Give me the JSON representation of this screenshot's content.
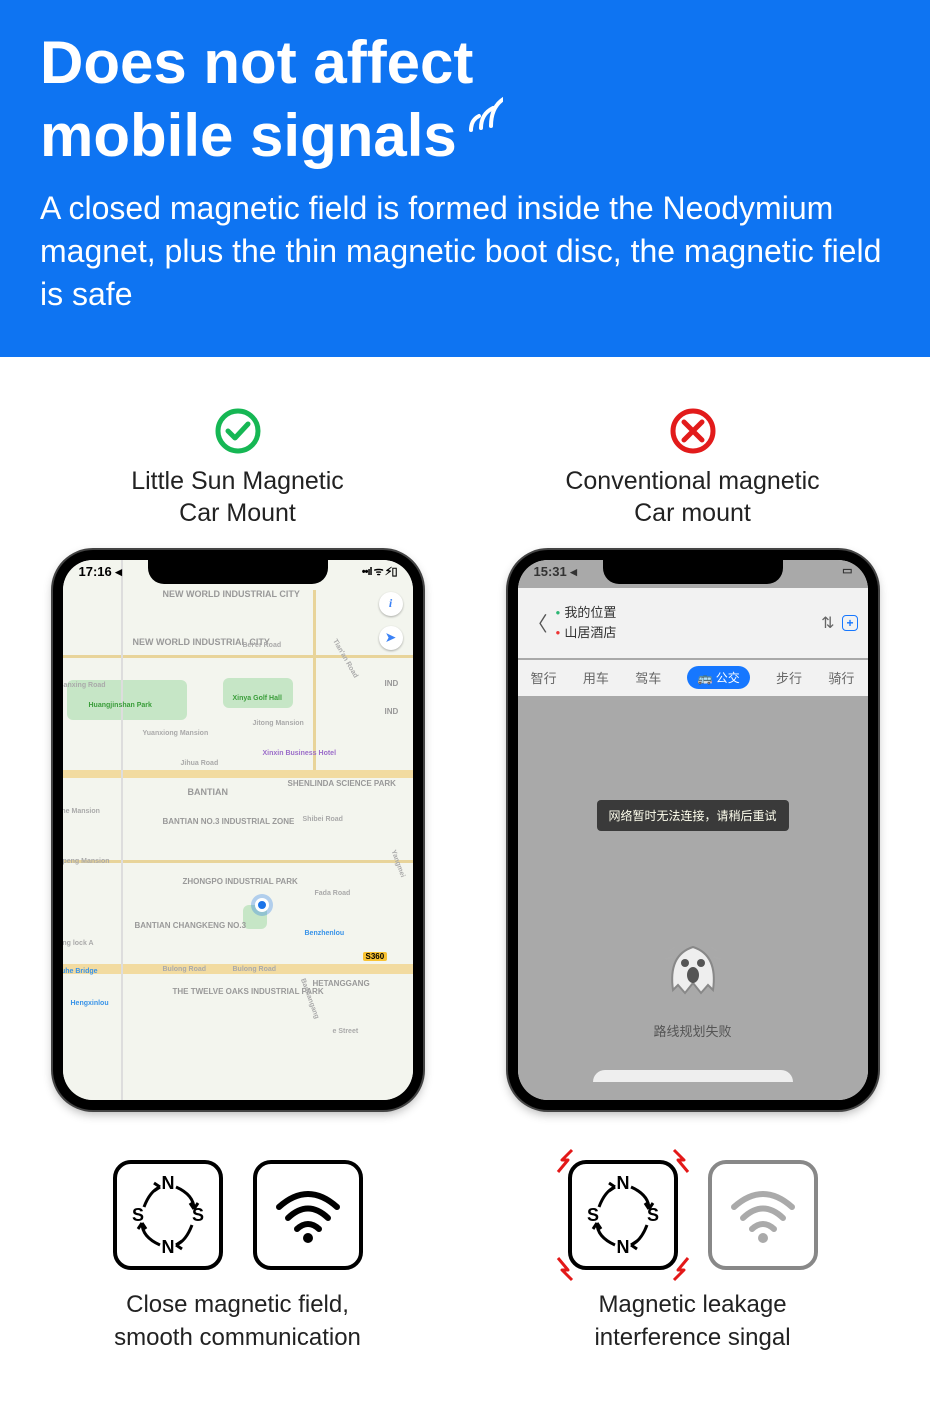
{
  "banner": {
    "title_line1": "Does not affect",
    "title_line2": "mobile signals",
    "subtitle": "A closed magnetic field is formed inside the Neodymium magnet, plus the thin magnetic boot disc, the magnetic field is safe"
  },
  "left": {
    "title_line1": "Little Sun Magnetic",
    "title_line2": "Car Mount",
    "status_time": "17:16",
    "map_labels": {
      "nw1": "NEW WORLD INDUSTRIAL CITY",
      "nw2": "NEW WORLD INDUSTRIAL CITY",
      "beier": "Bei'er Road",
      "tianan": "Tian'an Road",
      "banxing": "Banxing Road",
      "huang": "Huangjinshan Park",
      "xinya": "Xinya Golf Hall",
      "yuanxiong": "Yuanxiong Mansion",
      "jitong": "Jitong Mansion",
      "xinxin": "Xinxin Business Hotel",
      "jihua": "Jihua Road",
      "bantian": "BANTIAN",
      "shenlinda": "SHENLINDA SCIENCE PARK",
      "bn3": "BANTIAN NO.3 INDUSTRIAL ZONE",
      "shibei": "Shibei Road",
      "peng": "ipeng Mansion",
      "zhongpo": "ZHONGPO INDUSTRIAL PARK",
      "fada": "Fada Road",
      "bck": "BANTIAN CHANGKENG NO.3",
      "benzhen": "Benzhenlou",
      "s360": "S360",
      "bulong": "Bulong Road",
      "wuhe": "Wuhe Bridge",
      "hengxin": "Hengxinlou",
      "twelve": "THE TWELVE OAKS INDUSTRIAL PARK",
      "hetang": "HETANGGANG",
      "xing": "xing lock A",
      "ind": "IND",
      "she": "she Mansion",
      "bannangang": "Bannangang",
      "estreet": "e Street",
      "yangmei": "Yangmei"
    },
    "caption_line1": "Close magnetic field,",
    "caption_line2": "smooth communication"
  },
  "right": {
    "title_line1": "Conventional magnetic",
    "title_line2": "Car mount",
    "status_time": "15:31",
    "nav": {
      "loc_a": "我的位置",
      "loc_b": "山居酒店"
    },
    "tabs": [
      "智行",
      "用车",
      "驾车",
      "公交",
      "步行",
      "骑行"
    ],
    "active_tab": "公交",
    "toast": "网络暂时无法连接，请稍后重试",
    "fail_msg": "路线规划失败",
    "caption_line1": "Magnetic leakage",
    "caption_line2": "interference singal"
  },
  "compass_letters": {
    "n": "N",
    "s": "S"
  }
}
